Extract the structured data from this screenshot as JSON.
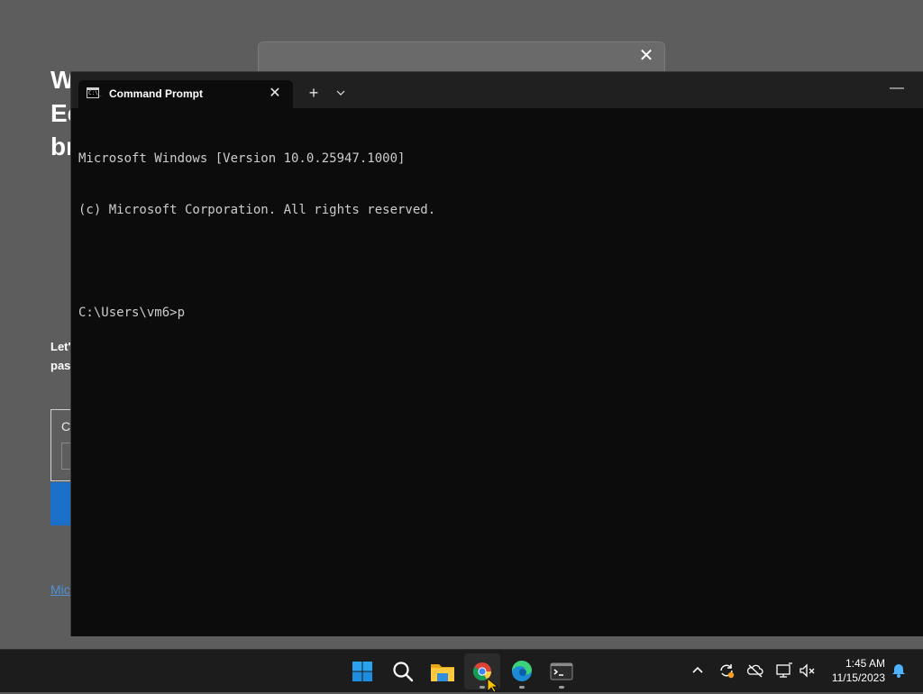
{
  "background_window": {
    "heading_partial": "W\nEc\nbr",
    "body_partial": "Let'\npas",
    "box_label_partial": "C",
    "link_partial": "Mic"
  },
  "terminal": {
    "tab_title": "Command Prompt",
    "tab_icon_text": "C:\\_",
    "close_glyph": "✕",
    "new_tab_glyph": "+",
    "dropdown_glyph": "⌵",
    "minimize_glyph": "—",
    "console_lines": [
      "Microsoft Windows [Version 10.0.25947.1000]",
      "(c) Microsoft Corporation. All rights reserved.",
      "",
      "C:\\Users\\vm6>p"
    ]
  },
  "taskbar": {
    "apps": [
      {
        "name": "start-button",
        "icon": "windows-logo-icon"
      },
      {
        "name": "search-button",
        "icon": "search-icon"
      },
      {
        "name": "file-explorer-button",
        "icon": "folder-icon"
      },
      {
        "name": "chrome-button",
        "icon": "chrome-icon",
        "active": true
      },
      {
        "name": "edge-button",
        "icon": "edge-icon"
      },
      {
        "name": "terminal-button",
        "icon": "terminal-icon"
      }
    ],
    "tray": {
      "overflow_glyph": "^",
      "icons": [
        "sync-icon",
        "cloud-off-icon",
        "network-icon",
        "volume-muted-icon",
        "notification-bell-icon"
      ]
    },
    "clock": {
      "time": "1:45 AM",
      "date": "11/15/2023"
    }
  },
  "colors": {
    "accent": "#0078d4",
    "console_text": "#cccccc",
    "console_bg": "#0c0c0c",
    "titlebar_bg": "#202020",
    "taskbar_bg": "#1c1c1c"
  }
}
